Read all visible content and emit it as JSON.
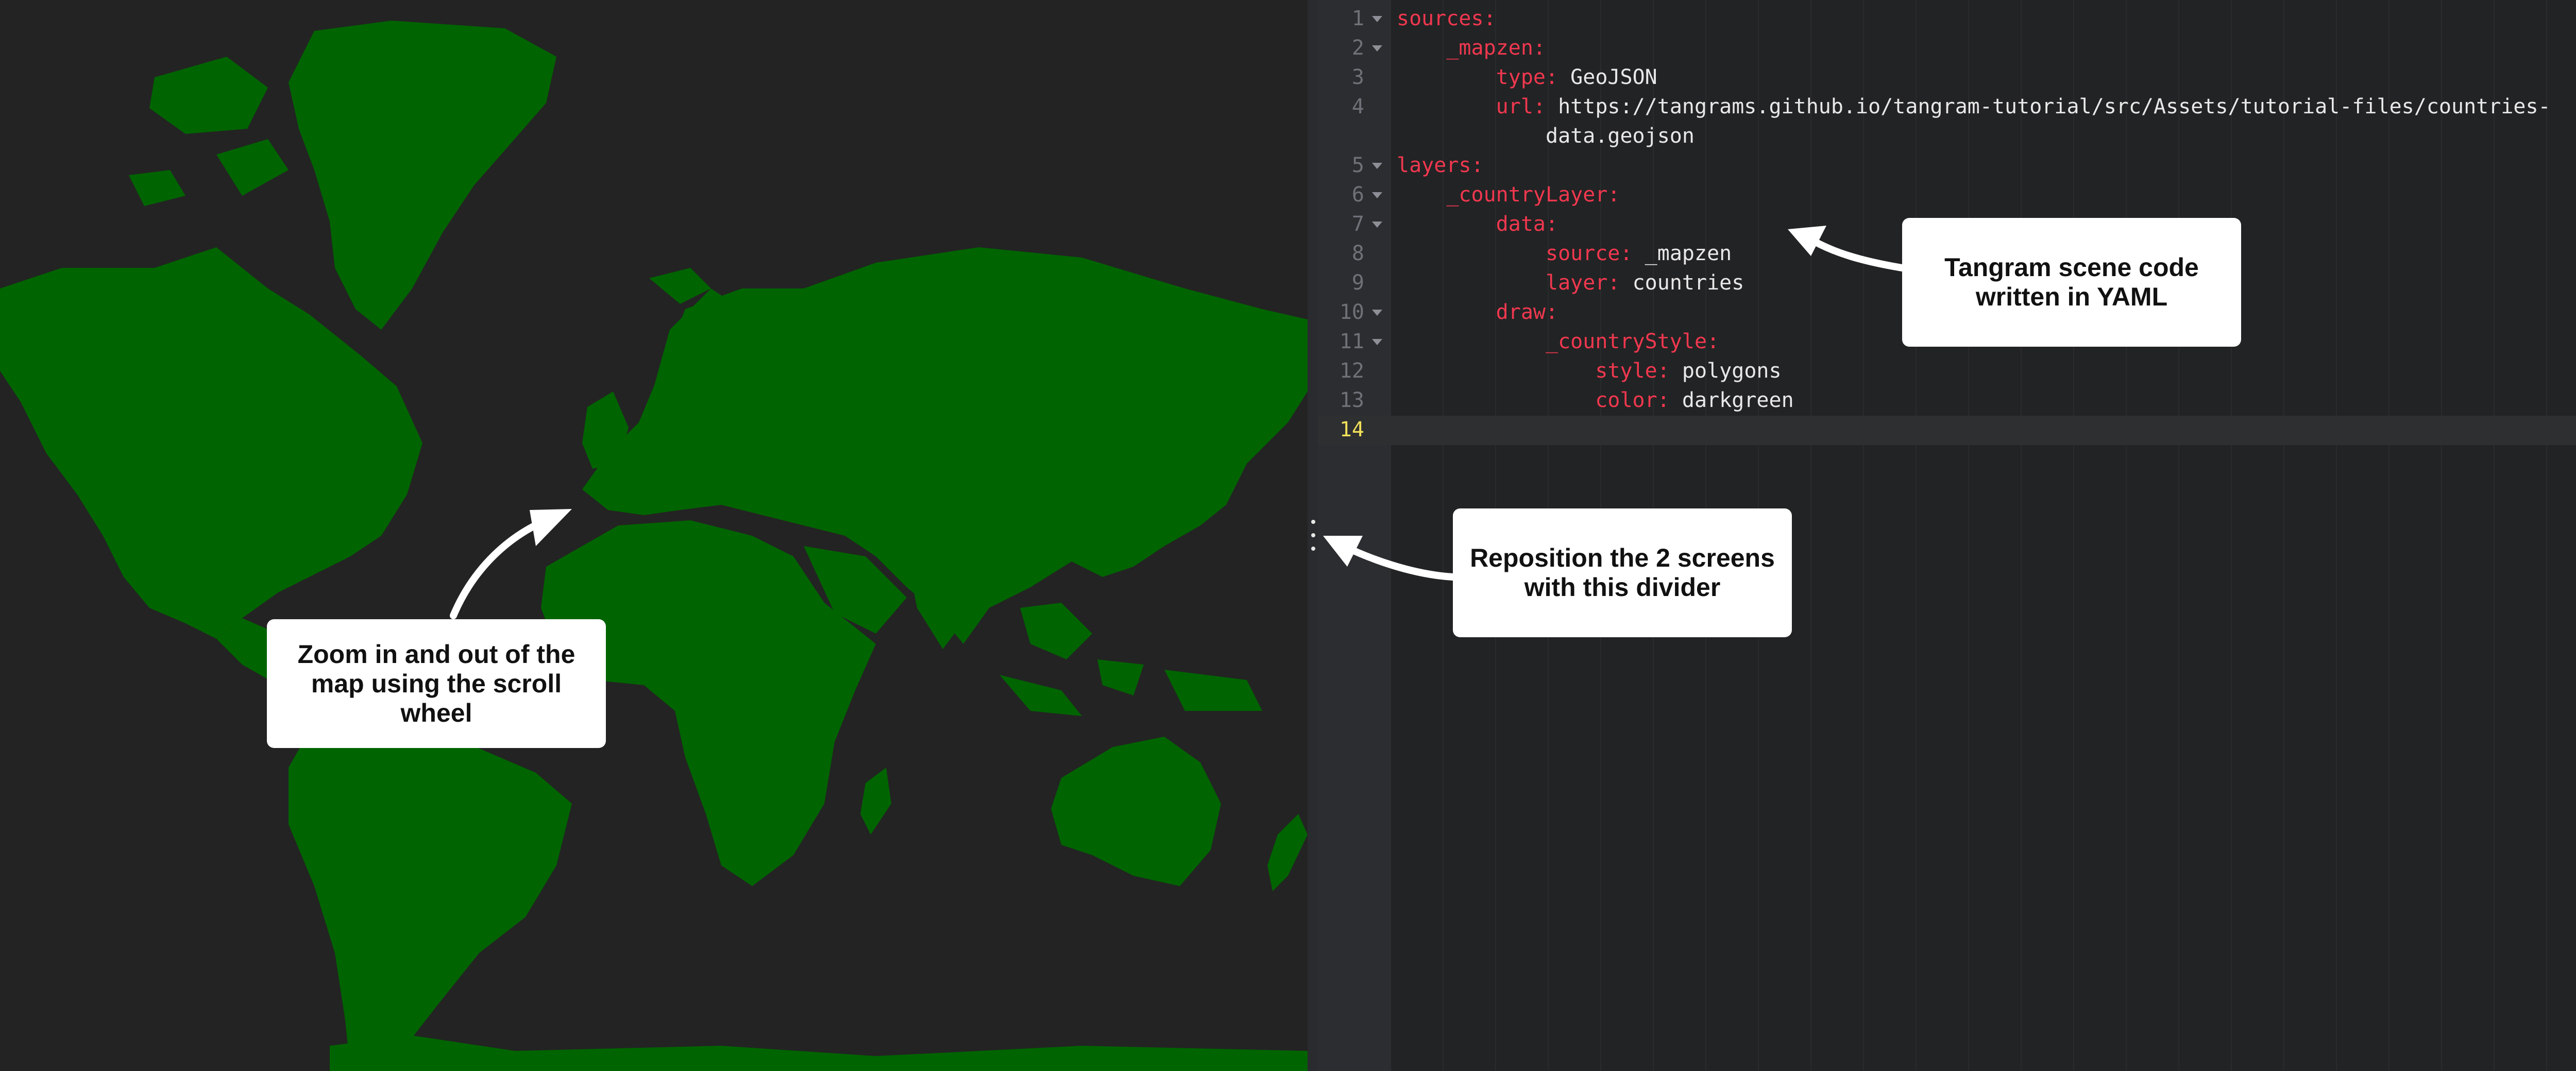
{
  "map": {
    "background_color": "#232323",
    "land_color": "#006400"
  },
  "divider": {
    "icon": "drag-handle-icon"
  },
  "editor": {
    "lines": [
      {
        "number": "1",
        "foldable": true,
        "indent": "",
        "key": "sources",
        "sep": ":",
        "value": ""
      },
      {
        "number": "2",
        "foldable": true,
        "indent": "    ",
        "key": "_mapzen",
        "sep": ":",
        "value": ""
      },
      {
        "number": "3",
        "foldable": false,
        "indent": "        ",
        "key": "type",
        "sep": ": ",
        "value": "GeoJSON"
      },
      {
        "number": "4",
        "foldable": false,
        "indent": "        ",
        "key": "url",
        "sep": ": ",
        "value": "https://tangrams.github.io/tangram-tutorial/src/Assets/tutorial-files/countries-"
      },
      {
        "number": "",
        "foldable": false,
        "indent": "            ",
        "key": "",
        "sep": "",
        "value": "data.geojson"
      },
      {
        "number": "5",
        "foldable": true,
        "indent": "",
        "key": "layers",
        "sep": ":",
        "value": ""
      },
      {
        "number": "6",
        "foldable": true,
        "indent": "    ",
        "key": "_countryLayer",
        "sep": ":",
        "value": ""
      },
      {
        "number": "7",
        "foldable": true,
        "indent": "        ",
        "key": "data",
        "sep": ":",
        "value": ""
      },
      {
        "number": "8",
        "foldable": false,
        "indent": "            ",
        "key": "source",
        "sep": ": ",
        "value": "_mapzen"
      },
      {
        "number": "9",
        "foldable": false,
        "indent": "            ",
        "key": "layer",
        "sep": ": ",
        "value": "countries"
      },
      {
        "number": "10",
        "foldable": true,
        "indent": "        ",
        "key": "draw",
        "sep": ":",
        "value": ""
      },
      {
        "number": "11",
        "foldable": true,
        "indent": "            ",
        "key": "_countryStyle",
        "sep": ":",
        "value": ""
      },
      {
        "number": "12",
        "foldable": false,
        "indent": "                ",
        "key": "style",
        "sep": ": ",
        "value": "polygons"
      },
      {
        "number": "13",
        "foldable": false,
        "indent": "                ",
        "key": "color",
        "sep": ": ",
        "value": "darkgreen"
      },
      {
        "number": "14",
        "foldable": false,
        "indent": "",
        "key": "",
        "sep": "",
        "value": ""
      }
    ],
    "current_line": "14",
    "colors": {
      "key": "#f0384f",
      "value": "#e8e8e8",
      "line_number": "#6e7178",
      "current_line_number": "#f1e05a"
    }
  },
  "callouts": {
    "map_zoom": "Zoom in and out of the map using the scroll wheel",
    "divider": "Reposition the 2 screens with this divider",
    "scene_code": "Tangram scene code written in YAML"
  }
}
